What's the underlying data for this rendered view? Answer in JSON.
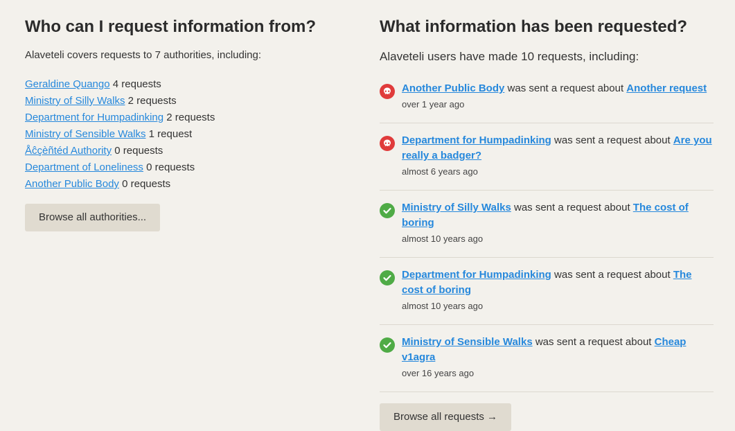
{
  "left": {
    "heading": "Who can I request information from?",
    "intro": "Alaveteli covers requests to 7 authorities, including:",
    "authorities": [
      {
        "name": "Geraldine Quango",
        "count": "4 requests"
      },
      {
        "name": "Ministry of Silly Walks",
        "count": "2 requests"
      },
      {
        "name": "Department for Humpadinking",
        "count": "2 requests"
      },
      {
        "name": "Ministry of Sensible Walks",
        "count": "1 request"
      },
      {
        "name": "Åĉçèñtéd Authority",
        "count": "0 requests"
      },
      {
        "name": "Department of Loneliness",
        "count": "0 requests"
      },
      {
        "name": "Another Public Body",
        "count": "0 requests"
      }
    ],
    "browse_button": "Browse all authorities..."
  },
  "right": {
    "heading": "What information has been requested?",
    "intro": "Alaveteli users have made 10 requests, including:",
    "connector": "was sent a request about",
    "requests": [
      {
        "status": "fail",
        "status_icon": "skull-icon",
        "body": "Another Public Body",
        "title": "Another request",
        "time": "over 1 year ago"
      },
      {
        "status": "fail",
        "status_icon": "skull-icon",
        "body": "Department for Humpadinking",
        "title": "Are you really a badger?",
        "time": "almost 6 years ago"
      },
      {
        "status": "ok",
        "status_icon": "check-icon",
        "body": "Ministry of Silly Walks",
        "title": "The cost of boring",
        "time": "almost 10 years ago"
      },
      {
        "status": "ok",
        "status_icon": "check-icon",
        "body": "Department for Humpadinking",
        "title": "The cost of boring",
        "time": "almost 10 years ago"
      },
      {
        "status": "ok",
        "status_icon": "check-icon",
        "body": "Ministry of Sensible Walks",
        "title": "Cheap v1agra",
        "time": "over 16 years ago"
      }
    ],
    "browse_button": "Browse all requests →"
  },
  "colors": {
    "background": "#f3f1ec",
    "link": "#2688dc",
    "button": "#e0dbd0",
    "status_fail": "#e03b3b",
    "status_ok": "#4fab46"
  }
}
